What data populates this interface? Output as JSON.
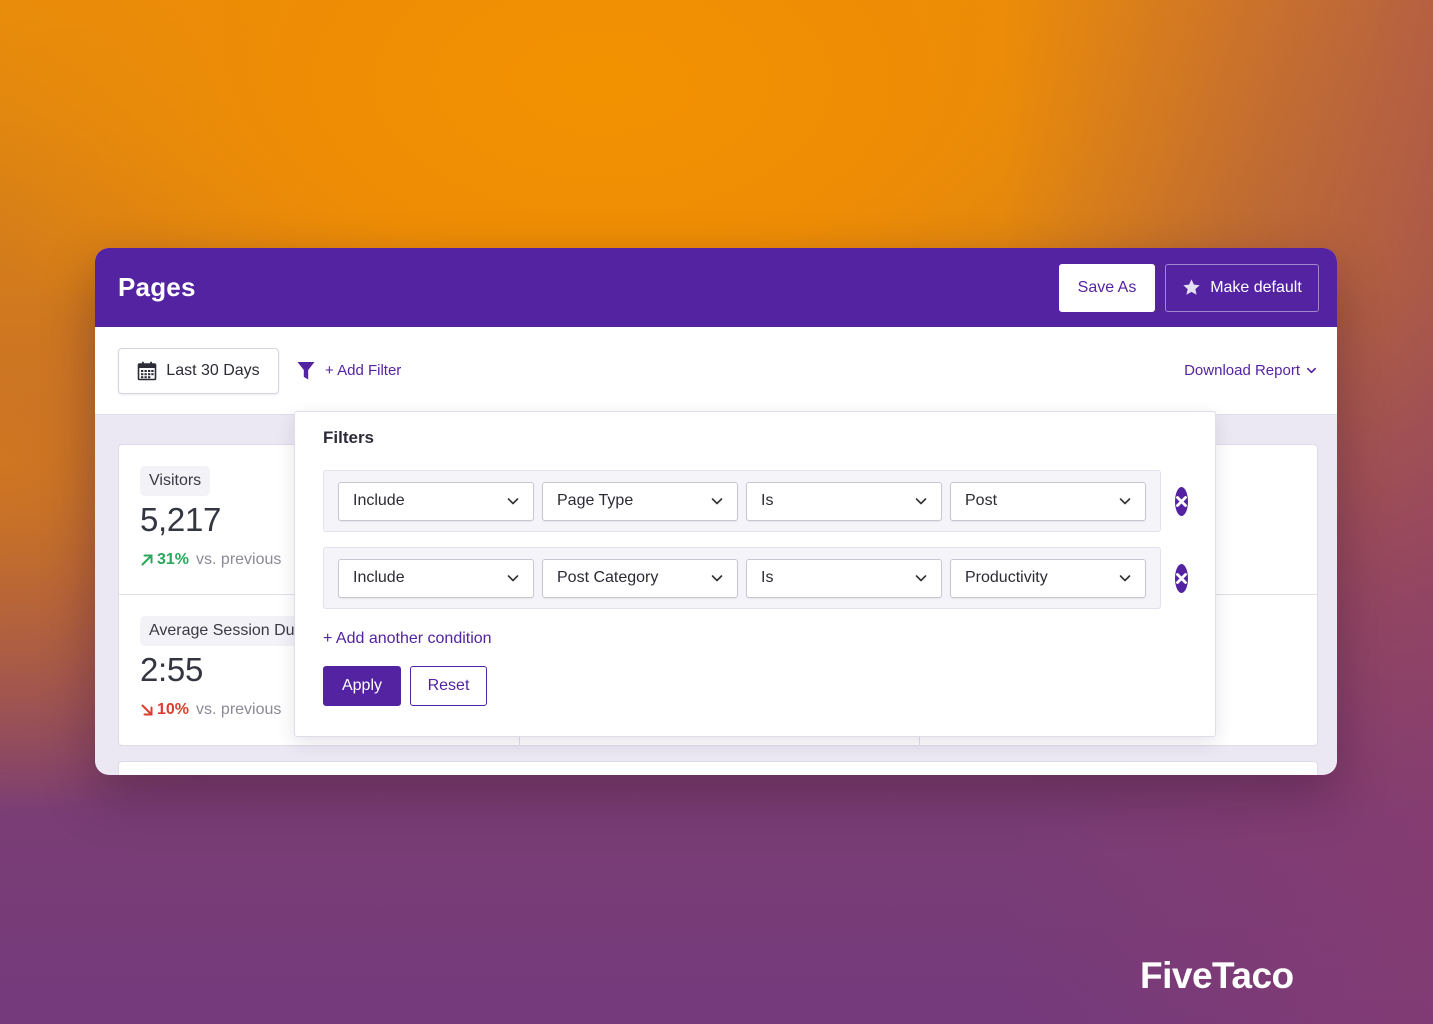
{
  "header": {
    "title": "Pages",
    "save_as_label": "Save As",
    "make_default_label": "Make default",
    "make_default_icon": "star-icon"
  },
  "toolbar": {
    "date_range_label": "Last 30 Days",
    "date_range_icon": "calendar-icon",
    "filter_icon": "funnel-icon",
    "add_filter_label": "+ Add Filter",
    "download_label": "Download Report"
  },
  "stats": [
    {
      "label": "Visitors",
      "value": "5,217",
      "change": "31%",
      "direction": "up",
      "comparison": "vs. previous"
    },
    {
      "label": "Average Session Duration",
      "value": "2:55",
      "change": "10%",
      "direction": "down",
      "comparison": "vs. previous"
    }
  ],
  "filters_panel": {
    "title": "Filters",
    "conditions": [
      {
        "mode": "Include",
        "field": "Page Type",
        "operator": "Is",
        "value": "Post"
      },
      {
        "mode": "Include",
        "field": "Post Category",
        "operator": "Is",
        "value": "Productivity"
      }
    ],
    "add_condition_label": "+ Add another condition",
    "apply_label": "Apply",
    "reset_label": "Reset"
  },
  "colors": {
    "brand_purple": "#5423a2",
    "positive": "#27a85a",
    "negative": "#dc3e2e"
  },
  "watermark": "FiveTaco"
}
